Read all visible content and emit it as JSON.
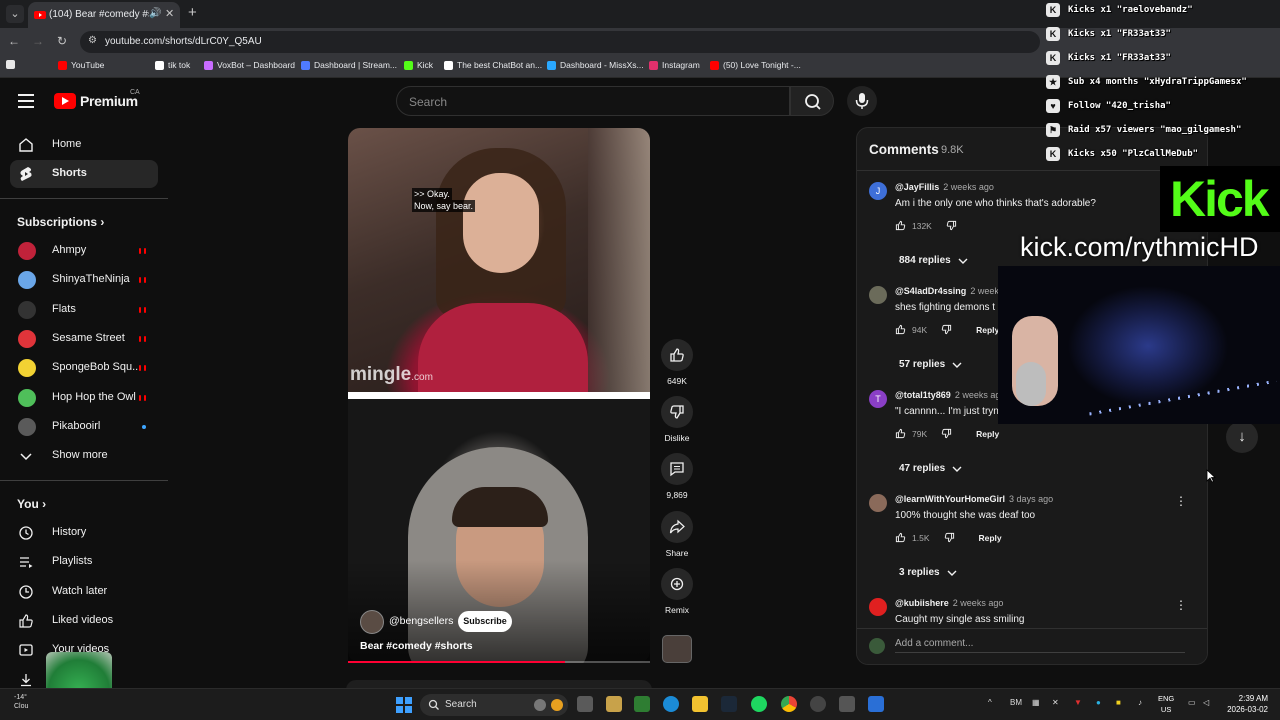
{
  "browser": {
    "tab_title": "(104) Bear #comedy #shorts",
    "url": "youtube.com/shorts/dLrC0Y_Q5AU",
    "bookmarks": [
      {
        "label": "",
        "color": "#e8e8e8"
      },
      {
        "label": "YouTube",
        "color": "#ff0000"
      },
      {
        "label": "tik tok",
        "color": "#ffffff"
      },
      {
        "label": "VoxBot – Dashboard",
        "color": "#c86cff"
      },
      {
        "label": "Dashboard | Stream...",
        "color": "#4f7bff"
      },
      {
        "label": "Kick",
        "color": "#53fc18"
      },
      {
        "label": "The best ChatBot an...",
        "color": "#ffffff"
      },
      {
        "label": "Dashboard - MissXs...",
        "color": "#2aa8ff"
      },
      {
        "label": "Instagram",
        "color": "#e1306c"
      },
      {
        "label": "(50) Love Tonight -...",
        "color": "#ff0000"
      }
    ]
  },
  "masthead": {
    "logo_text": "Premium",
    "country": "CA",
    "search_placeholder": "Search"
  },
  "sidebar": {
    "primary": [
      {
        "label": "Home",
        "icon": "home-icon"
      },
      {
        "label": "Shorts",
        "icon": "shorts-icon"
      }
    ],
    "subscriptions_heading": "Subscriptions",
    "subscriptions": [
      {
        "label": "Ahmpy",
        "color": "#c0223a",
        "status": "live"
      },
      {
        "label": "ShinyaTheNinja",
        "color": "#6aa6e8",
        "status": "live"
      },
      {
        "label": "Flats",
        "color": "#333333",
        "status": "live"
      },
      {
        "label": "Sesame Street",
        "color": "#e0343a",
        "status": "live"
      },
      {
        "label": "SpongeBob Squ...",
        "color": "#f2d233",
        "status": "live"
      },
      {
        "label": "Hop Hop the Owl",
        "color": "#4fbf5a",
        "status": "live"
      },
      {
        "label": "Pikabooirl",
        "color": "#5a5a5a",
        "status": "new"
      }
    ],
    "show_more": "Show more",
    "you_heading": "You",
    "you_items": [
      {
        "label": "History",
        "icon": "history-icon"
      },
      {
        "label": "Playlists",
        "icon": "playlists-icon"
      },
      {
        "label": "Watch later",
        "icon": "watch-later-icon"
      },
      {
        "label": "Liked videos",
        "icon": "liked-videos-icon"
      },
      {
        "label": "Your videos",
        "icon": "your-videos-icon"
      },
      {
        "label": "",
        "icon": "downloads-icon"
      }
    ]
  },
  "short": {
    "caption_line1": ">> Okay.",
    "caption_line2": "Now, say bear.",
    "watermark": "mingle",
    "watermark_suffix": ".com",
    "channel": "@bengsellers",
    "subscribe_label": "Subscribe",
    "title": "Bear #comedy #shorts",
    "progress": 0.72
  },
  "actions": {
    "like_count": "649K",
    "dislike_label": "Dislike",
    "comment_count": "9,869",
    "share_label": "Share",
    "remix_label": "Remix"
  },
  "comments": {
    "title": "Comments",
    "count": "9.8K",
    "items": [
      {
        "avatar_letter": "J",
        "avatar_color": "#3e6fd8",
        "author": "@JayFillis",
        "time": "2 weeks ago",
        "text": "Am i the only one who thinks that's adorable?",
        "likes": "132K",
        "replies": "884 replies"
      },
      {
        "avatar_letter": "",
        "avatar_color": "#6b6b5a",
        "author": "@S4ladDr4ssing",
        "time": "2 weeks",
        "text": "shes fighting demons t",
        "likes": "94K",
        "reply_label": "Reply",
        "replies": "57 replies"
      },
      {
        "avatar_letter": "T",
        "avatar_color": "#8a3fc6",
        "author": "@total1ty869",
        "time": "2 weeks ag",
        "text": "\"I cannnn... I'm just tryn",
        "likes": "79K",
        "reply_label": "Reply",
        "replies": "47 replies"
      },
      {
        "avatar_letter": "",
        "avatar_color": "#8a6a5a",
        "author": "@learnWithYourHomeGirl",
        "time": "3 days ago",
        "text": "100% thought she was deaf too",
        "likes": "1.5K",
        "reply_label": "Reply",
        "replies": "3 replies"
      },
      {
        "avatar_letter": "",
        "avatar_color": "#e02020",
        "author": "@kubiishere",
        "time": "2 weeks ago",
        "text": "Caught my single ass smiling"
      }
    ],
    "add_placeholder": "Add a comment..."
  },
  "stream": {
    "alerts": [
      {
        "icon": "kick-icon",
        "text": "Kicks x1 \"raelovebandz\""
      },
      {
        "icon": "kick-icon",
        "text": "Kicks x1 \"FR33at33\""
      },
      {
        "icon": "kick-icon",
        "text": "Kicks x1 \"FR33at33\""
      },
      {
        "icon": "star-icon",
        "text": "Sub x4 months \"xHydraTrippGamesx\""
      },
      {
        "icon": "heart-icon",
        "text": "Follow \"420_trisha\""
      },
      {
        "icon": "raid-icon",
        "text": "Raid x57 viewers \"mao_gilgamesh\""
      },
      {
        "icon": "kick-icon",
        "text": "Kicks x50 \"PlzCallMeDub\""
      }
    ],
    "kick_logo": "Kick",
    "kick_url": "kick.com/rythmicHD"
  },
  "taskbar": {
    "weather_temp": "-14°",
    "weather_desc": "Clou",
    "search_label": "Search",
    "lang_1": "ENG",
    "lang_2": "US",
    "time": "2:39 AM",
    "date": "2026-03-02"
  }
}
